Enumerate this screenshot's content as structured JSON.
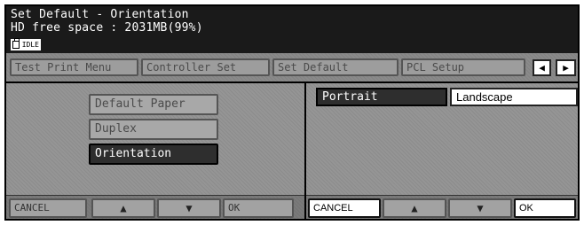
{
  "header": {
    "title": "Set Default - Orientation",
    "free_space": "HD free space : 2031MB(99%)",
    "status": "IDLE"
  },
  "tabs": [
    {
      "label": "Test Print Menu"
    },
    {
      "label": "Controller Set"
    },
    {
      "label": "Set Default"
    },
    {
      "label": "PCL Setup"
    }
  ],
  "nav": {
    "prev_icon": "◀",
    "next_icon": "▶"
  },
  "menu": [
    {
      "label": "Default Paper"
    },
    {
      "label": "Duplex"
    },
    {
      "label": "Orientation"
    }
  ],
  "left_bar": {
    "cancel": "CANCEL",
    "up": "▲",
    "down": "▼",
    "ok": "OK"
  },
  "orientation": {
    "portrait": "Portrait",
    "landscape": "Landscape",
    "selected": "Portrait"
  },
  "right_bar": {
    "cancel": "CANCEL",
    "up": "▲",
    "down": "▼",
    "ok": "OK"
  }
}
